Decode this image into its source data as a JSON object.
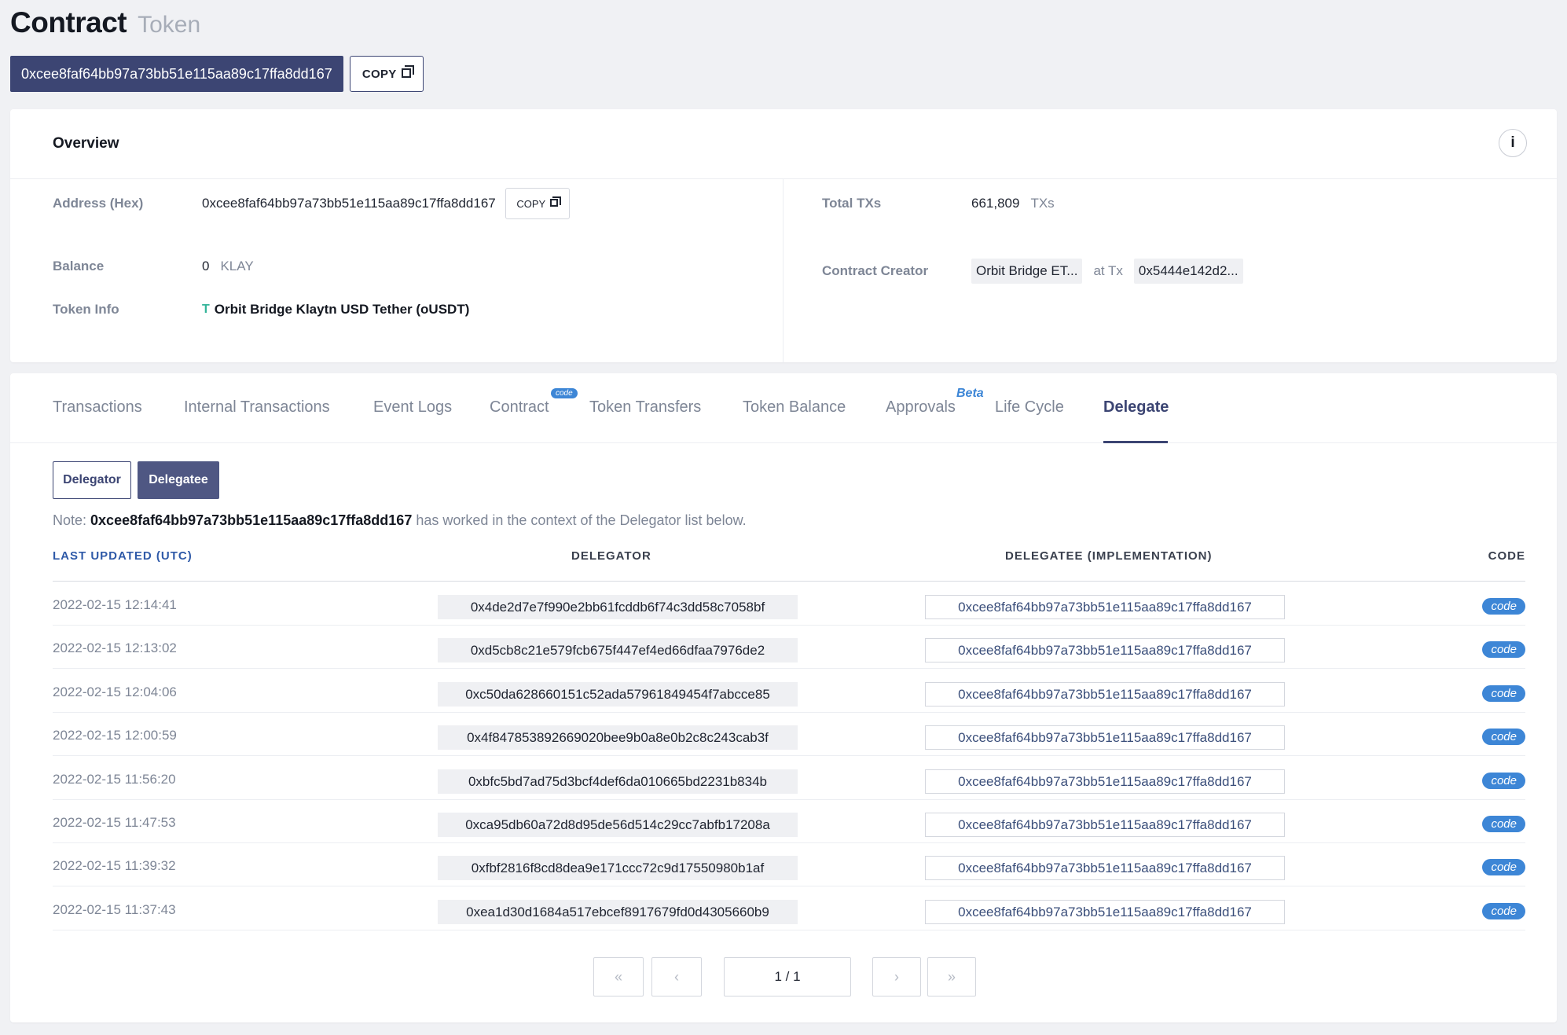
{
  "header": {
    "title": "Contract",
    "subtitle": "Token"
  },
  "address_bar": {
    "address": "0xcee8faf64bb97a73bb51e115aa89c17ffa8dd167",
    "copy_label": "COPY"
  },
  "overview": {
    "title": "Overview",
    "info_label": "i",
    "address_hex_label": "Address (Hex)",
    "address_hex_value": "0xcee8faf64bb97a73bb51e115aa89c17ffa8dd167",
    "copy_label": "COPY",
    "balance_label": "Balance",
    "balance_value": "0",
    "balance_unit": "KLAY",
    "token_info_label": "Token Info",
    "token_icon": "T",
    "token_name": "Orbit Bridge Klaytn USD Tether (oUSDT)",
    "total_txs_label": "Total TXs",
    "total_txs_value": "661,809",
    "total_txs_unit": "TXs",
    "creator_label": "Contract Creator",
    "creator_value": "Orbit Bridge ET...",
    "at_tx_label": "at Tx",
    "creator_tx": "0x5444e142d2..."
  },
  "tabs": {
    "transactions": "Transactions",
    "internal": "Internal Transactions",
    "event_logs": "Event Logs",
    "contract": "Contract",
    "contract_badge": "code",
    "token_transfers": "Token Transfers",
    "token_balance": "Token Balance",
    "approvals": "Approvals",
    "approvals_badge": "Beta",
    "life_cycle": "Life Cycle",
    "delegate": "Delegate"
  },
  "delegate": {
    "toggle_delegator": "Delegator",
    "toggle_delegatee": "Delegatee",
    "note_prefix": "Note: ",
    "note_address": "0xcee8faf64bb97a73bb51e115aa89c17ffa8dd167",
    "note_suffix": " has worked in the context of the Delegator list below.",
    "columns": {
      "last_updated": "LAST UPDATED (UTC)",
      "delegator": "DELEGATOR",
      "delegatee": "DELEGATEE (IMPLEMENTATION)",
      "code": "CODE"
    },
    "rows": [
      {
        "date": "2022-02-15 12:14:41",
        "delegator": "0x4de2d7e7f990e2bb61fcddb6f74c3dd58c7058bf",
        "delegatee": "0xcee8faf64bb97a73bb51e115aa89c17ffa8dd167",
        "code": "code"
      },
      {
        "date": "2022-02-15 12:13:02",
        "delegator": "0xd5cb8c21e579fcb675f447ef4ed66dfaa7976de2",
        "delegatee": "0xcee8faf64bb97a73bb51e115aa89c17ffa8dd167",
        "code": "code"
      },
      {
        "date": "2022-02-15 12:04:06",
        "delegator": "0xc50da628660151c52ada57961849454f7abcce85",
        "delegatee": "0xcee8faf64bb97a73bb51e115aa89c17ffa8dd167",
        "code": "code"
      },
      {
        "date": "2022-02-15 12:00:59",
        "delegator": "0x4f847853892669020bee9b0a8e0b2c8c243cab3f",
        "delegatee": "0xcee8faf64bb97a73bb51e115aa89c17ffa8dd167",
        "code": "code"
      },
      {
        "date": "2022-02-15 11:56:20",
        "delegator": "0xbfc5bd7ad75d3bcf4def6da010665bd2231b834b",
        "delegatee": "0xcee8faf64bb97a73bb51e115aa89c17ffa8dd167",
        "code": "code"
      },
      {
        "date": "2022-02-15 11:47:53",
        "delegator": "0xca95db60a72d8d95de56d514c29cc7abfb17208a",
        "delegatee": "0xcee8faf64bb97a73bb51e115aa89c17ffa8dd167",
        "code": "code"
      },
      {
        "date": "2022-02-15 11:39:32",
        "delegator": "0xfbf2816f8cd8dea9e171ccc72c9d17550980b1af",
        "delegatee": "0xcee8faf64bb97a73bb51e115aa89c17ffa8dd167",
        "code": "code"
      },
      {
        "date": "2022-02-15 11:37:43",
        "delegator": "0xea1d30d1684a517ebcef8917679fd0d4305660b9",
        "delegatee": "0xcee8faf64bb97a73bb51e115aa89c17ffa8dd167",
        "code": "code"
      }
    ]
  },
  "pagination": {
    "first": "«",
    "prev": "‹",
    "page": "1 / 1",
    "next": "›",
    "last": "»"
  },
  "colors": {
    "primary": "#3c4573",
    "accent_blue": "#3d86d6",
    "background": "#f0f1f4"
  }
}
